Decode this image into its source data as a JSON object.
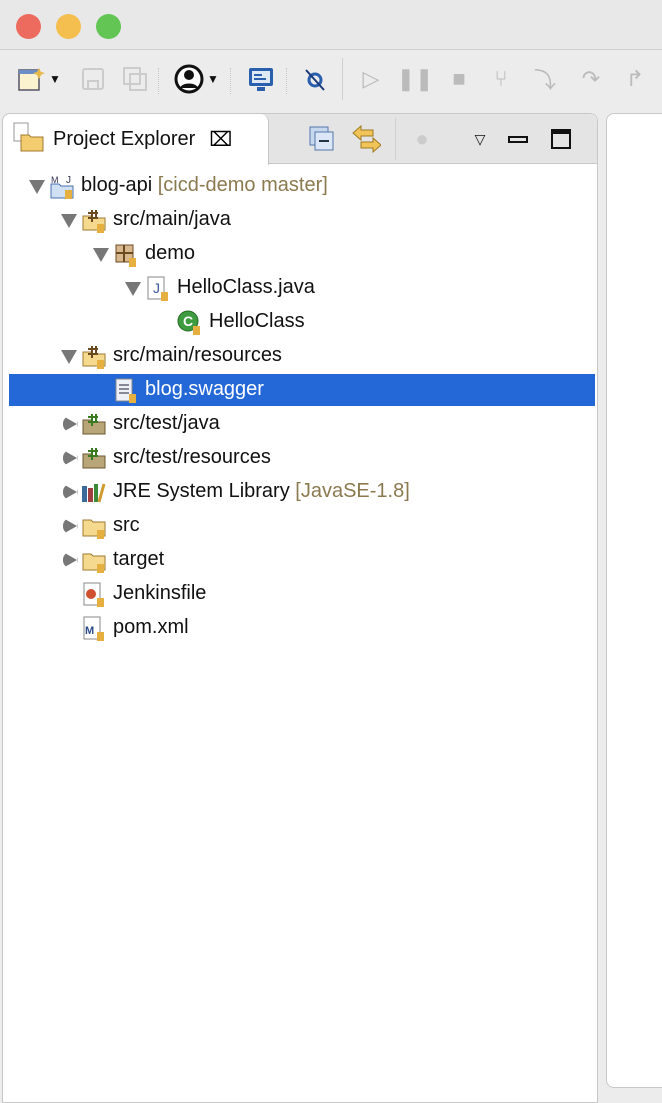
{
  "window": {
    "controls": {
      "close_color": "#ed6a5e",
      "minimize_color": "#f5bf4f",
      "zoom_color": "#62c554"
    }
  },
  "toolbar": {
    "icons": [
      "new-wizard-icon",
      "save-icon",
      "save-all-icon",
      "account-icon",
      "console-icon",
      "skip-breakpoints-icon",
      "resume-icon",
      "suspend-icon",
      "terminate-icon",
      "disconnect-icon",
      "step-into-icon",
      "step-over-icon",
      "step-return-icon"
    ]
  },
  "view": {
    "tab_label": "Project Explorer",
    "close_glyph": "⌧"
  },
  "tree": [
    {
      "label": "blog-api",
      "decoration": "[cicd-demo master]",
      "level": 0,
      "expander": "down",
      "icon": "maven-project-icon"
    },
    {
      "label": "src/main/java",
      "decoration": "",
      "level": 1,
      "expander": "down",
      "icon": "source-folder-icon"
    },
    {
      "label": "demo",
      "decoration": "",
      "level": 2,
      "expander": "down",
      "icon": "package-icon"
    },
    {
      "label": "HelloClass.java",
      "decoration": "",
      "level": 3,
      "expander": "down",
      "icon": "java-file-icon"
    },
    {
      "label": "HelloClass",
      "decoration": "",
      "level": 4,
      "expander": "none",
      "icon": "class-icon"
    },
    {
      "label": "src/main/resources",
      "decoration": "",
      "level": 1,
      "expander": "down",
      "icon": "source-folder-icon"
    },
    {
      "label": "blog.swagger",
      "decoration": "",
      "level": 2,
      "expander": "none",
      "icon": "text-file-icon",
      "selected": true
    },
    {
      "label": "src/test/java",
      "decoration": "",
      "level": 1,
      "expander": "right",
      "icon": "test-folder-icon"
    },
    {
      "label": "src/test/resources",
      "decoration": "",
      "level": 1,
      "expander": "right",
      "icon": "test-folder-icon"
    },
    {
      "label": "JRE System Library",
      "decoration": "[JavaSE-1.8]",
      "level": 1,
      "expander": "right",
      "icon": "library-icon"
    },
    {
      "label": "src",
      "decoration": "",
      "level": 1,
      "expander": "right",
      "icon": "folder-icon"
    },
    {
      "label": "target",
      "decoration": "",
      "level": 1,
      "expander": "right",
      "icon": "folder-icon"
    },
    {
      "label": "Jenkinsfile",
      "decoration": "",
      "level": 1,
      "expander": "none",
      "icon": "jenkins-file-icon"
    },
    {
      "label": "pom.xml",
      "decoration": "",
      "level": 1,
      "expander": "none",
      "icon": "maven-pom-icon"
    }
  ],
  "colors": {
    "selection": "#2468d8",
    "decoration": "#8b7a50"
  }
}
